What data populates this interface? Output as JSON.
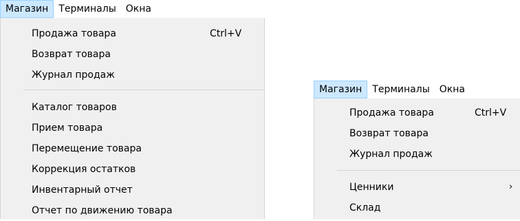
{
  "panel1": {
    "menubar": [
      "Магазин",
      "Терминалы",
      "Окна"
    ],
    "items": [
      {
        "label": "Продажа товара",
        "shortcut": "Ctrl+V"
      },
      {
        "label": "Возврат товара"
      },
      {
        "label": "Журнал продаж"
      },
      {
        "label": "Каталог товаров"
      },
      {
        "label": "Прием товара"
      },
      {
        "label": "Перемещение товара"
      },
      {
        "label": "Коррекция остатков"
      },
      {
        "label": "Инвентарный отчет"
      },
      {
        "label": "Отчет по движению товара"
      }
    ]
  },
  "panel2": {
    "menubar": [
      "Магазин",
      "Терминалы",
      "Окна"
    ],
    "items": [
      {
        "label": "Продажа товара",
        "shortcut": "Ctrl+V"
      },
      {
        "label": "Возврат товара"
      },
      {
        "label": "Журнал продаж"
      },
      {
        "label": "Ценники",
        "arrow": "›"
      },
      {
        "label": "Склад"
      }
    ]
  }
}
